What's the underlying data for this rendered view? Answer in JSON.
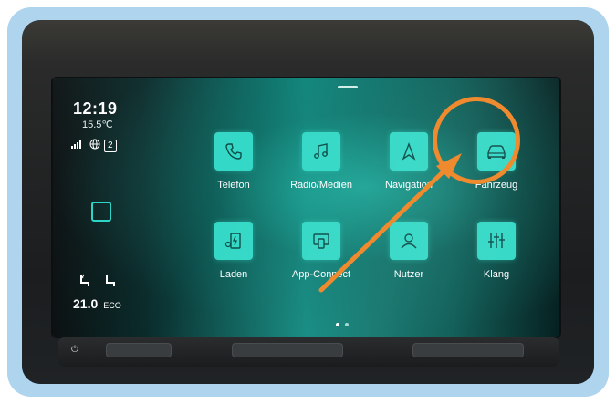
{
  "status": {
    "clock": "12:19",
    "outside_temp": "15.5℃",
    "network": "4G",
    "badge": "2"
  },
  "climate": {
    "temperature": "21.0",
    "mode": "ECO"
  },
  "apps": [
    {
      "label": "Telefon",
      "icon": "phone-icon"
    },
    {
      "label": "Radio/Medien",
      "icon": "music-note-icon"
    },
    {
      "label": "Navigation",
      "icon": "navigation-arrow-icon"
    },
    {
      "label": "Fahrzeug",
      "icon": "car-icon"
    },
    {
      "label": "Laden",
      "icon": "charging-icon"
    },
    {
      "label": "App-Connect",
      "icon": "app-connect-icon"
    },
    {
      "label": "Nutzer",
      "icon": "user-icon"
    },
    {
      "label": "Klang",
      "icon": "equalizer-icon"
    }
  ],
  "pagination": {
    "current": 1,
    "total": 2
  },
  "colors": {
    "tile": "#34d8c6",
    "annotation": "#ef8a2e",
    "frame_outer": "#aed4ee",
    "frame_inner": "#1a73c0"
  }
}
